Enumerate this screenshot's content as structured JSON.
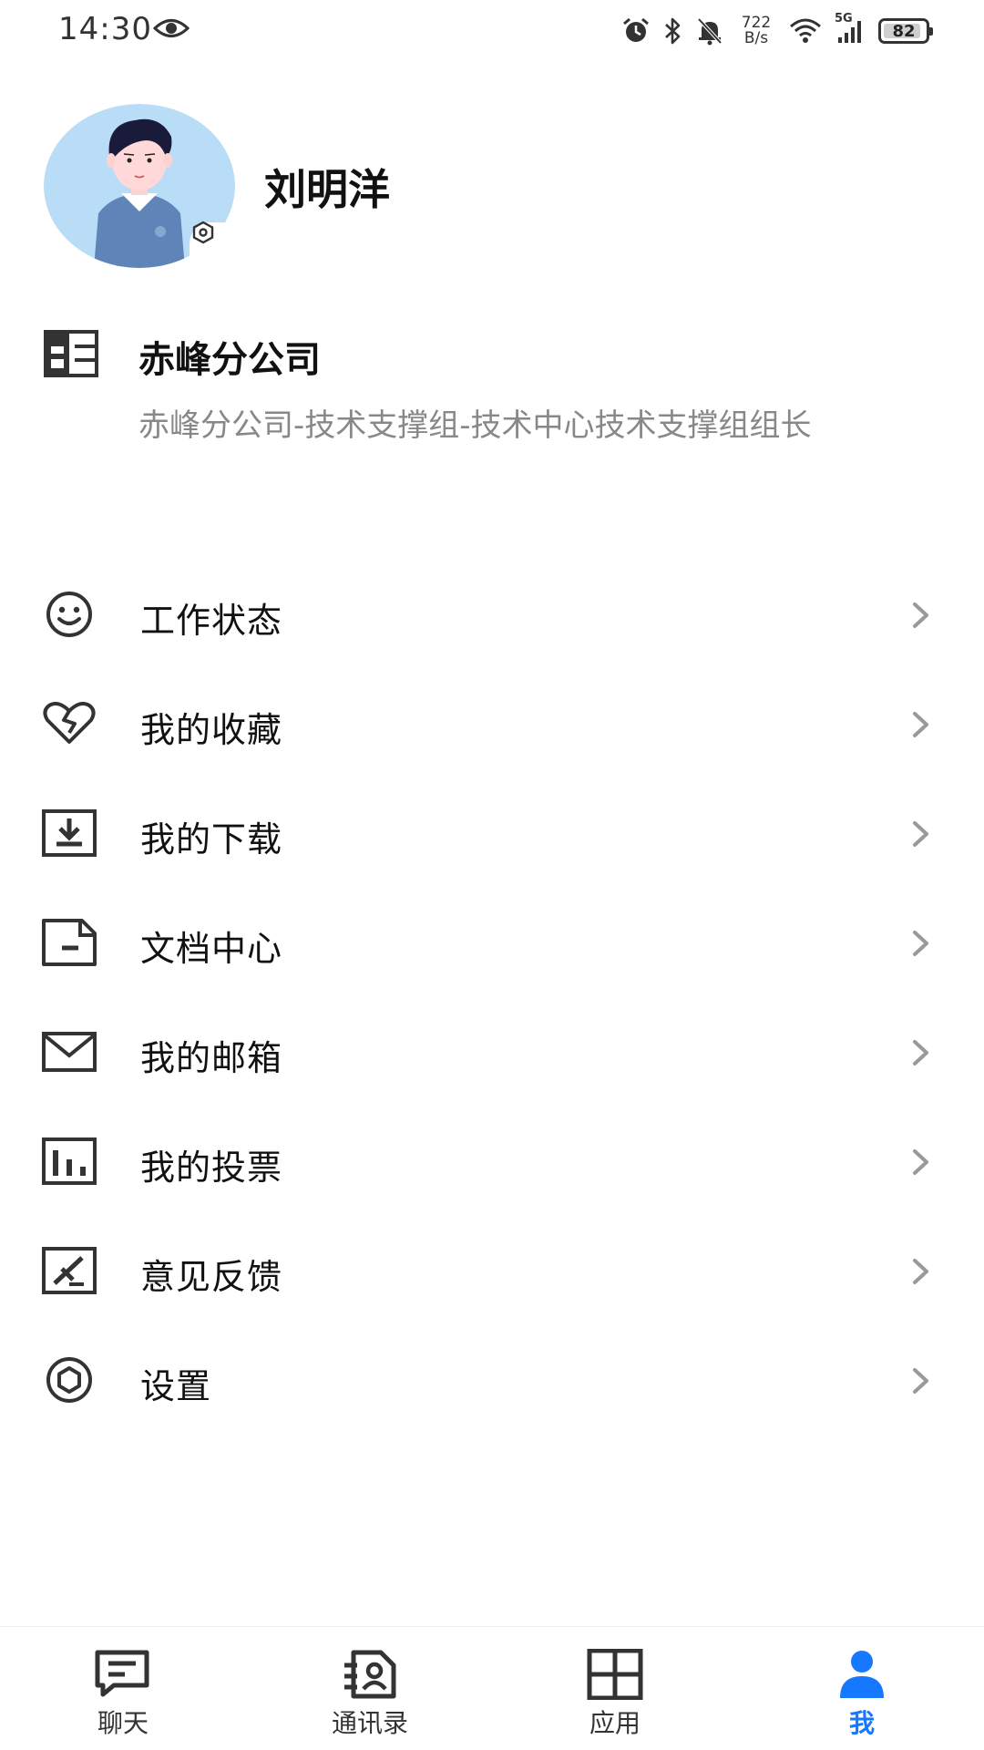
{
  "status_bar": {
    "time": "14:30",
    "net_speed_value": "722",
    "net_speed_unit": "B/s",
    "network_type": "5G",
    "battery": "82",
    "icons": [
      "eye-icon",
      "alarm-icon",
      "bluetooth-icon",
      "mute-icon",
      "wifi-icon",
      "signal-icon",
      "battery-icon"
    ]
  },
  "profile": {
    "name": "刘明洋"
  },
  "organization": {
    "name": "赤峰分公司",
    "department": "赤峰分公司-技术支撑组-技术中心技术支撑组组长"
  },
  "menu": [
    {
      "label": "工作状态",
      "icon": "smile-icon"
    },
    {
      "label": "我的收藏",
      "icon": "heart-icon"
    },
    {
      "label": "我的下载",
      "icon": "download-icon"
    },
    {
      "label": "文档中心",
      "icon": "document-icon"
    },
    {
      "label": "我的邮箱",
      "icon": "mail-icon"
    },
    {
      "label": "我的投票",
      "icon": "vote-chart-icon"
    },
    {
      "label": "意见反馈",
      "icon": "feedback-icon"
    },
    {
      "label": "设置",
      "icon": "settings-icon"
    }
  ],
  "bottom_nav": {
    "items": [
      {
        "label": "聊天",
        "icon": "chat-icon"
      },
      {
        "label": "通讯录",
        "icon": "contacts-icon"
      },
      {
        "label": "应用",
        "icon": "apps-grid-icon"
      },
      {
        "label": "我",
        "icon": "user-icon"
      }
    ],
    "active": "我"
  },
  "colors": {
    "accent": "#1677ff",
    "text_primary": "#111111",
    "text_secondary": "#888888",
    "icon": "#333333",
    "arrow": "#999999",
    "avatar_bg": "#b9dcf7"
  }
}
